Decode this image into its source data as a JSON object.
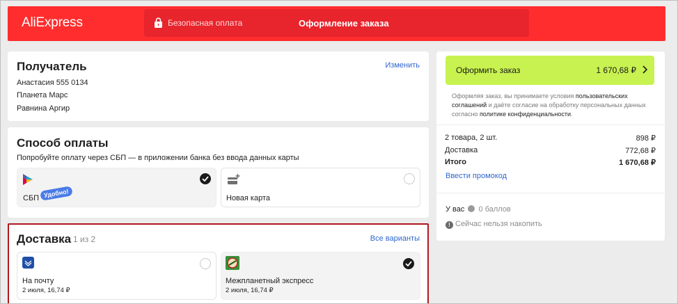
{
  "header": {
    "logo": "AliExpress",
    "secure_label": "Безопасная оплата",
    "title": "Оформление заказа",
    "brand_color": "#ff2d2d"
  },
  "recipient": {
    "title": "Получатель",
    "edit_link": "Изменить",
    "name_phone": "Анастасия 555 0134",
    "planet": "Планета Марс",
    "region": "Равнина Аргир"
  },
  "payment": {
    "title": "Способ оплаты",
    "hint": "Попробуйте оплату через СБП — в приложении банка без ввода данных карты",
    "options": [
      {
        "label": "СБП",
        "badge": "Удобно!",
        "icon": "sbp-icon",
        "selected": true
      },
      {
        "label": "Новая карта",
        "icon": "card-plus-icon",
        "selected": false
      }
    ]
  },
  "delivery": {
    "title": "Доставка",
    "counter": "1 из 2",
    "all_link": "Все варианты",
    "options": [
      {
        "label": "На почту",
        "detail": "2 июля, 16,74 ₽",
        "icon": "post-icon",
        "selected": false
      },
      {
        "label": "Межпланетный экспресс",
        "detail": "2 июля, 16,74 ₽",
        "icon": "express-icon",
        "selected": true
      }
    ]
  },
  "summary": {
    "order_button": "Оформить заказ",
    "order_total": "1 670,68 ₽",
    "terms": {
      "p1": "Оформляя заказ, вы принимаете условия ",
      "l1": "пользовательских соглашений",
      "p2": " и даёте согласие на обработку персональных данных согласно ",
      "l2": "политике конфиденциальности",
      "p3": "."
    },
    "items_label": "2 товара, 2 шт.",
    "items_value": "898 ₽",
    "shipping_label": "Доставка",
    "shipping_value": "772,68 ₽",
    "total_label": "Итого",
    "total_value": "1 670,68 ₽",
    "promo_link": "Ввести промокод",
    "points_prefix": "У вас",
    "points_value": "0 баллов",
    "points_note": "Сейчас нельзя накопить",
    "accent_color": "#c8f250"
  }
}
